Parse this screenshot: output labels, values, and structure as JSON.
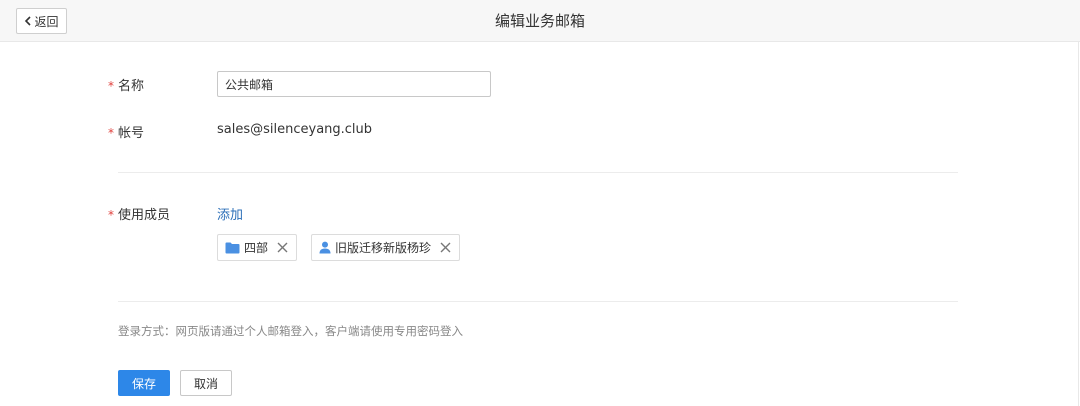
{
  "header": {
    "back_label": "返回",
    "title": "编辑业务邮箱"
  },
  "form": {
    "required_mark": "*",
    "name_label": "名称",
    "name_value": "公共邮箱",
    "account_label": "帐号",
    "account_value": "sales@silenceyang.club",
    "members_label": "使用成员",
    "add_label": "添加",
    "members": [
      {
        "type": "department",
        "icon": "folder-icon",
        "name": "四部"
      },
      {
        "type": "user",
        "icon": "user-icon",
        "name": "旧版迁移新版杨珍"
      }
    ],
    "login_note": "登录方式：网页版请通过个人邮箱登入，客户端请使用专用密码登入",
    "save_label": "保存",
    "cancel_label": "取消"
  },
  "colors": {
    "primary": "#2d87e8",
    "link": "#2b6fb8",
    "required": "#e0403c",
    "folder": "#4a90e2"
  }
}
